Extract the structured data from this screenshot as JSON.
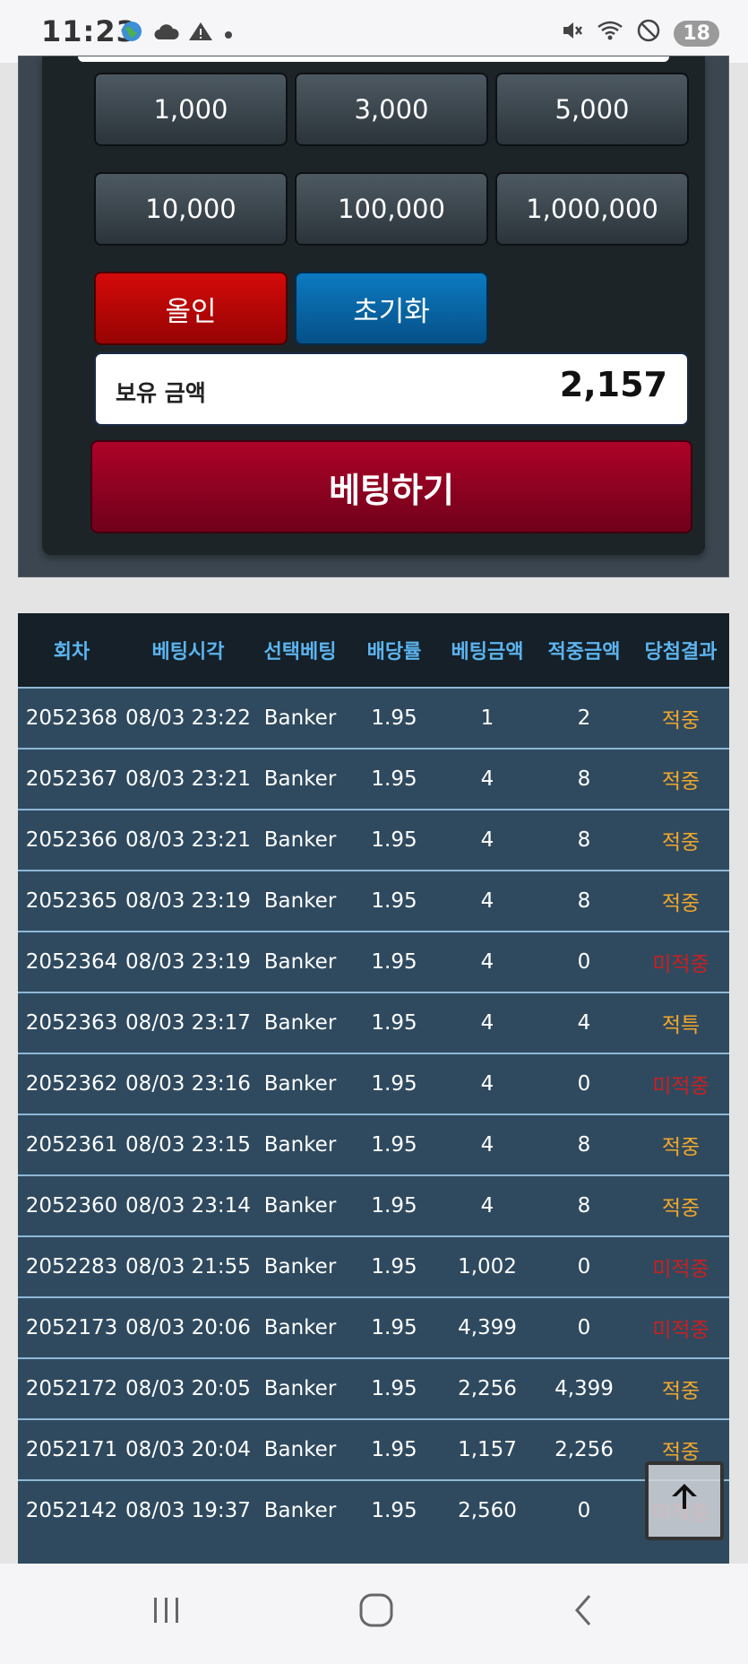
{
  "status_bar": {
    "time": "11:23",
    "left_icons": [
      "globe-icon",
      "cloud-icon",
      "warning-icon",
      "dot-icon"
    ],
    "right_icons": [
      "mute-icon",
      "wifi-icon",
      "blocked-icon"
    ],
    "battery": "18"
  },
  "bet_panel": {
    "chips": [
      "1,000",
      "3,000",
      "5,000",
      "10,000",
      "100,000",
      "1,000,000"
    ],
    "allin_label": "올인",
    "reset_label": "초기화",
    "balance_label": "보유 금액",
    "balance_value": "2,157",
    "submit_label": "베팅하기"
  },
  "history": {
    "headers": [
      "회차",
      "베팅시각",
      "선택베팅",
      "배당률",
      "베팅금액",
      "적중금액",
      "당첨결과"
    ],
    "rows": [
      {
        "round": "2052368",
        "time": "08/03 23:22",
        "choice": "Banker",
        "odds": "1.95",
        "bet": "1",
        "win": "2",
        "result": "적중",
        "status": "hit"
      },
      {
        "round": "2052367",
        "time": "08/03 23:21",
        "choice": "Banker",
        "odds": "1.95",
        "bet": "4",
        "win": "8",
        "result": "적중",
        "status": "hit"
      },
      {
        "round": "2052366",
        "time": "08/03 23:21",
        "choice": "Banker",
        "odds": "1.95",
        "bet": "4",
        "win": "8",
        "result": "적중",
        "status": "hit"
      },
      {
        "round": "2052365",
        "time": "08/03 23:19",
        "choice": "Banker",
        "odds": "1.95",
        "bet": "4",
        "win": "8",
        "result": "적중",
        "status": "hit"
      },
      {
        "round": "2052364",
        "time": "08/03 23:19",
        "choice": "Banker",
        "odds": "1.95",
        "bet": "4",
        "win": "0",
        "result": "미적중",
        "status": "miss"
      },
      {
        "round": "2052363",
        "time": "08/03 23:17",
        "choice": "Banker",
        "odds": "1.95",
        "bet": "4",
        "win": "4",
        "result": "적특",
        "status": "tie"
      },
      {
        "round": "2052362",
        "time": "08/03 23:16",
        "choice": "Banker",
        "odds": "1.95",
        "bet": "4",
        "win": "0",
        "result": "미적중",
        "status": "miss"
      },
      {
        "round": "2052361",
        "time": "08/03 23:15",
        "choice": "Banker",
        "odds": "1.95",
        "bet": "4",
        "win": "8",
        "result": "적중",
        "status": "hit"
      },
      {
        "round": "2052360",
        "time": "08/03 23:14",
        "choice": "Banker",
        "odds": "1.95",
        "bet": "4",
        "win": "8",
        "result": "적중",
        "status": "hit"
      },
      {
        "round": "2052283",
        "time": "08/03 21:55",
        "choice": "Banker",
        "odds": "1.95",
        "bet": "1,002",
        "win": "0",
        "result": "미적중",
        "status": "miss"
      },
      {
        "round": "2052173",
        "time": "08/03 20:06",
        "choice": "Banker",
        "odds": "1.95",
        "bet": "4,399",
        "win": "0",
        "result": "미적중",
        "status": "miss"
      },
      {
        "round": "2052172",
        "time": "08/03 20:05",
        "choice": "Banker",
        "odds": "1.95",
        "bet": "2,256",
        "win": "4,399",
        "result": "적중",
        "status": "hit"
      },
      {
        "round": "2052171",
        "time": "08/03 20:04",
        "choice": "Banker",
        "odds": "1.95",
        "bet": "1,157",
        "win": "2,256",
        "result": "적중",
        "status": "hit"
      },
      {
        "round": "2052142",
        "time": "08/03 19:37",
        "choice": "Banker",
        "odds": "1.95",
        "bet": "2,560",
        "win": "0",
        "result": "미적중",
        "status": "miss"
      }
    ]
  },
  "scroll_top_icon": "arrow-up-icon",
  "nav_bar": {
    "recents_icon": "recents-icon",
    "home_icon": "home-icon",
    "back_icon": "back-icon"
  },
  "colors": {
    "hit": "#f3a72a",
    "miss": "#cc1f1f",
    "header_text": "#5cb4ef",
    "table_bg": "#2f4a5f"
  }
}
